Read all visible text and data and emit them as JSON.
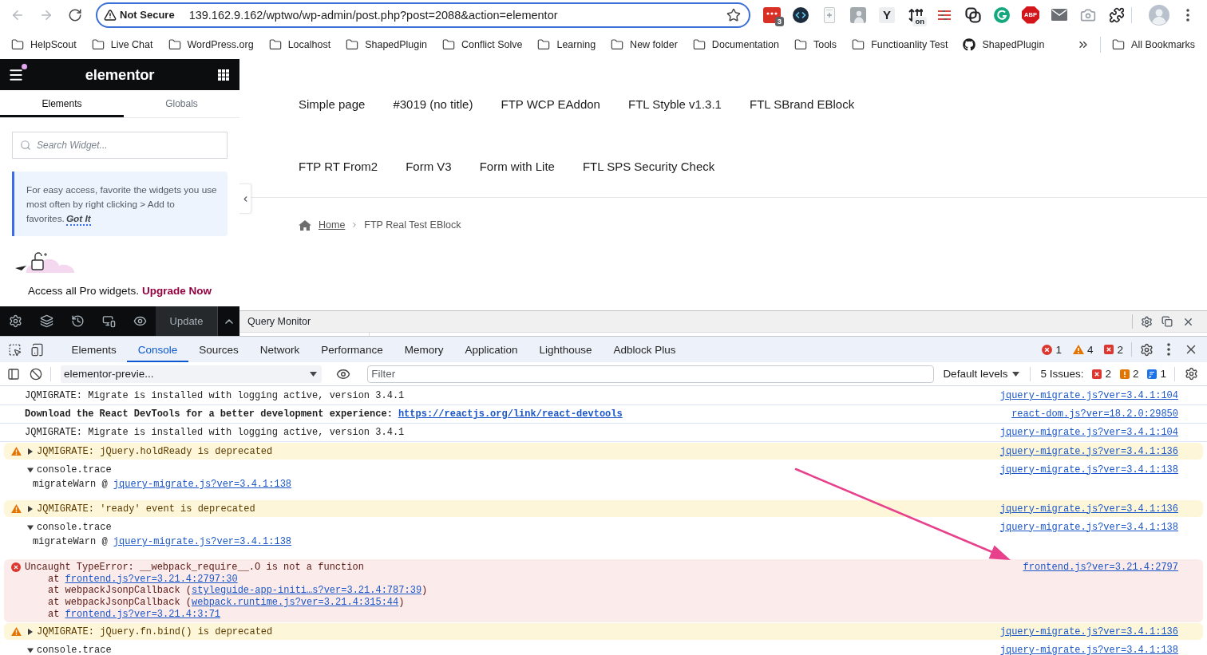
{
  "browser": {
    "nav_buttons": [
      {
        "kind": "back",
        "disabled": true
      },
      {
        "kind": "forward",
        "disabled": true
      },
      {
        "kind": "reload",
        "disabled": false
      }
    ],
    "security_label": "Not Secure",
    "url": "139.162.9.162/wptwo/wp-admin/post.php?post=2088&action=elementor",
    "extensions": [
      {
        "kind": "calendar",
        "badge": "3"
      },
      {
        "kind": "code"
      },
      {
        "kind": "note"
      },
      {
        "kind": "photo"
      },
      {
        "kind": "letter",
        "glyph": "Y"
      },
      {
        "kind": "sort",
        "badge": "on"
      },
      {
        "kind": "lines"
      },
      {
        "kind": "links"
      },
      {
        "kind": "grammar"
      },
      {
        "kind": "octagon",
        "glyph": "ABP"
      },
      {
        "kind": "mail"
      },
      {
        "kind": "camera"
      },
      {
        "kind": "puzzle"
      }
    ]
  },
  "bookmarks": {
    "items": [
      {
        "kind": "folder",
        "label": "HelpScout"
      },
      {
        "kind": "folder",
        "label": "Live Chat"
      },
      {
        "kind": "folder",
        "label": "WordPress.org"
      },
      {
        "kind": "folder",
        "label": "Localhost"
      },
      {
        "kind": "folder",
        "label": "ShapedPlugin"
      },
      {
        "kind": "folder",
        "label": "Conflict Solve"
      },
      {
        "kind": "folder",
        "label": "Learning"
      },
      {
        "kind": "folder",
        "label": "New folder"
      },
      {
        "kind": "folder",
        "label": "Documentation"
      },
      {
        "kind": "folder",
        "label": "Tools"
      },
      {
        "kind": "folder",
        "label": "Functioanlity Test"
      },
      {
        "kind": "github",
        "label": "ShapedPlugin"
      }
    ],
    "all": "All Bookmarks"
  },
  "elementor_panel": {
    "logo": "elementor",
    "tabs": [
      {
        "label": "Elements",
        "selected": true
      },
      {
        "label": "Globals",
        "selected": false
      }
    ],
    "search": {
      "placeholder": "Search Widget..."
    },
    "tip": {
      "text": "For easy access, favorite the widgets you use most often by right clicking > Add to favorites.",
      "action": "Got It"
    },
    "promo": {
      "text": "Access all Pro widgets.",
      "link": "Upgrade Now"
    },
    "update_button": "Update"
  },
  "preview": {
    "menu_rows": [
      {
        "items": [
          "Simple page",
          "#3019 (no title)",
          "FTP WCP EAddon",
          "FTL Styble v1.3.1",
          "FTL SBrand EBlock"
        ]
      },
      {
        "items": [
          "FTP RT From2",
          "Form V3",
          "Form with Lite",
          "FTL SPS Security Check"
        ]
      }
    ],
    "breadcrumb": {
      "home": "Home",
      "current": "FTP Real Test EBlock"
    }
  },
  "query_monitor": {
    "title": "Query Monitor"
  },
  "devtools": {
    "tabs": [
      {
        "label": "Elements",
        "selected": false
      },
      {
        "label": "Console",
        "selected": true
      },
      {
        "label": "Sources",
        "selected": false
      },
      {
        "label": "Network",
        "selected": false
      },
      {
        "label": "Performance",
        "selected": false
      },
      {
        "label": "Memory",
        "selected": false
      },
      {
        "label": "Application",
        "selected": false
      },
      {
        "label": "Lighthouse",
        "selected": false
      },
      {
        "label": "Adblock Plus",
        "selected": false
      }
    ],
    "counters": [
      {
        "kind": "error",
        "count": "1"
      },
      {
        "kind": "warning",
        "count": "4"
      },
      {
        "kind": "issue",
        "count": "2"
      }
    ],
    "context": "elementor-previe...",
    "filter": {
      "placeholder": "Filter"
    },
    "levels": "Default levels",
    "issues": {
      "label": "5 Issues:",
      "counters": [
        {
          "kind": "error",
          "count": "2"
        },
        {
          "kind": "warning",
          "count": "2"
        },
        {
          "kind": "info",
          "count": "1"
        }
      ]
    },
    "messages": [
      {
        "kind": "log",
        "bold": false,
        "text": "JQMIGRATE: Migrate is installed with logging active, version 3.4.1",
        "source": "jquery-migrate.js?ver=3.4.1:104"
      },
      {
        "kind": "log",
        "bold": true,
        "text": "Download the React DevTools for a better development experience:",
        "link": "https://reactjs.org/link/react-devtools",
        "source": "react-dom.js?ver=18.2.0:29850"
      },
      {
        "kind": "log",
        "bold": false,
        "text": "JQMIGRATE: Migrate is installed with logging active, version 3.4.1",
        "source": "jquery-migrate.js?ver=3.4.1:104"
      },
      {
        "kind": "warning",
        "expanded": false,
        "text": "JQMIGRATE: jQuery.holdReady is deprecated",
        "source": "jquery-migrate.js?ver=3.4.1:136"
      },
      {
        "kind": "trace",
        "expanded": true,
        "text": "console.trace",
        "source": "jquery-migrate.js?ver=3.4.1:138",
        "frames": [
          {
            "before": "migrateWarn @ ",
            "link": "jquery-migrate.js?ver=3.4.1:138"
          }
        ]
      },
      {
        "kind": "warning",
        "expanded": false,
        "text": "JQMIGRATE: 'ready' event is deprecated",
        "source": "jquery-migrate.js?ver=3.4.1:136"
      },
      {
        "kind": "trace",
        "expanded": true,
        "text": "console.trace",
        "source": "jquery-migrate.js?ver=3.4.1:138",
        "frames": [
          {
            "before": "migrateWarn @ ",
            "link": "jquery-migrate.js?ver=3.4.1:138"
          }
        ]
      },
      {
        "kind": "error",
        "text": "Uncaught TypeError: __webpack_require__.O is not a function",
        "source": "frontend.js?ver=3.21.4:2797",
        "frames": [
          {
            "before": "at ",
            "link": "frontend.js?ver=3.21.4:2797:30"
          },
          {
            "before": "at webpackJsonpCallback (",
            "link": "styleguide-app-initi…s?ver=3.21.4:787:39",
            "after": ")"
          },
          {
            "before": "at webpackJsonpCallback (",
            "link": "webpack.runtime.js?ver=3.21.4:315:44",
            "after": ")"
          },
          {
            "before": "at ",
            "link": "frontend.js?ver=3.21.4:3:71"
          }
        ]
      },
      {
        "kind": "warning",
        "expanded": false,
        "text": "JQMIGRATE: jQuery.fn.bind() is deprecated",
        "source": "jquery-migrate.js?ver=3.4.1:136"
      },
      {
        "kind": "trace",
        "expanded": true,
        "text": "console.trace",
        "source": "jquery-migrate.js?ver=3.4.1:138"
      }
    ]
  }
}
